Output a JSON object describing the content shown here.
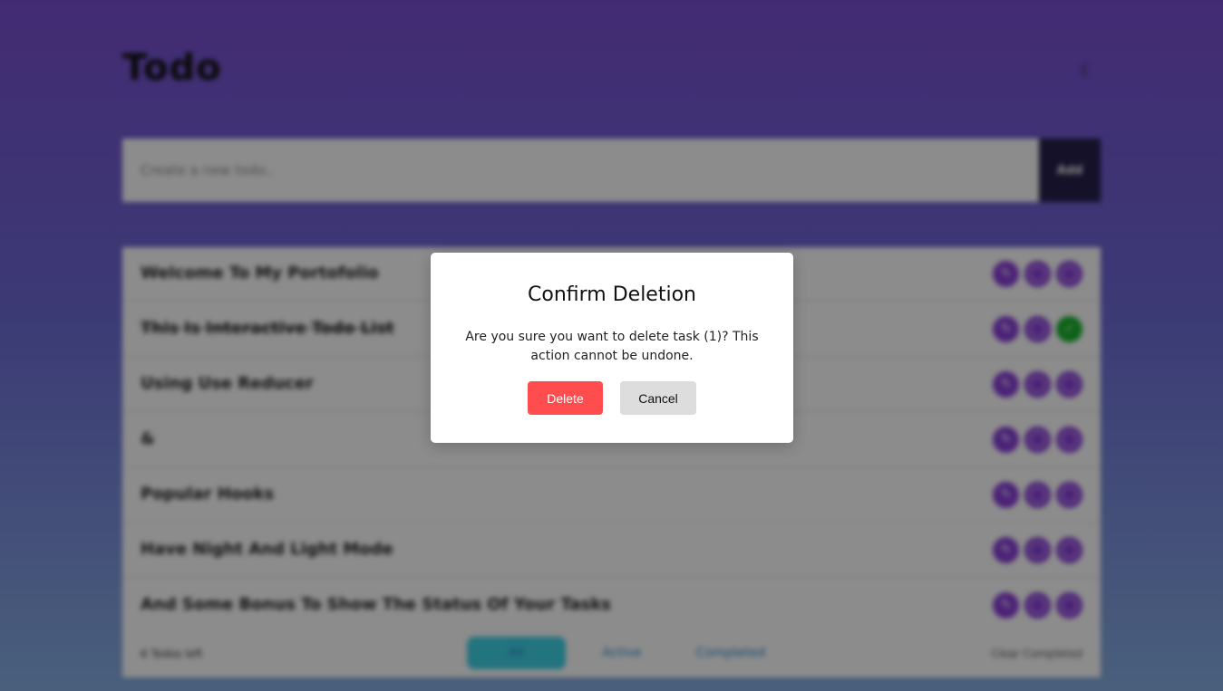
{
  "colors": {
    "accent": "#8b3fd9",
    "completed_check": "#18b32c",
    "delete_button": "#ff4d4f",
    "cancel_button": "#dddddd",
    "add_button": "#25204a",
    "active_filter": "#3fd3e8"
  },
  "header": {
    "title": "Todo",
    "theme_icon": "moon-icon",
    "theme_glyph": "☾"
  },
  "form": {
    "placeholder": "Create a new todo..",
    "add_label": "Add"
  },
  "todos": [
    {
      "text": "Welcome To My Portofolio",
      "completed": false
    },
    {
      "text": "This Is Interactive Todo List",
      "completed": true
    },
    {
      "text": "Using Use Reducer",
      "completed": false
    },
    {
      "text": "&",
      "completed": false
    },
    {
      "text": "Popular Hooks",
      "completed": false
    },
    {
      "text": "Have Night And Light Mode",
      "completed": false
    },
    {
      "text": "And Some Bonus To Show The Status Of Your Tasks",
      "completed": false
    }
  ],
  "footer": {
    "items_left": "6 Todos left",
    "filters": [
      "All",
      "Active",
      "Completed"
    ],
    "active_filter": "All",
    "clear_completed": "Clear Completed"
  },
  "modal": {
    "title": "Confirm Deletion",
    "message": "Are you sure you want to delete task (1)? This action cannot be undone.",
    "delete_label": "Delete",
    "cancel_label": "Cancel"
  }
}
